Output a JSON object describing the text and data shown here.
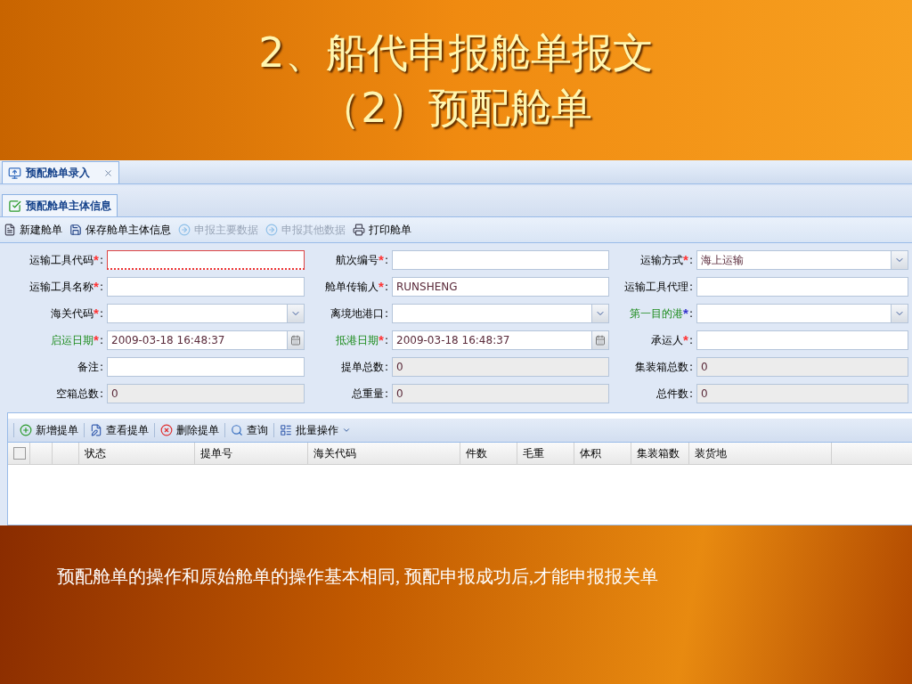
{
  "slide": {
    "title_lines": [
      "2、船代申报舱单报文",
      "（2）预配舱单"
    ],
    "caption": "预配舱单的操作和原始舱单的操作基本相同, 预配申报成功后,才能申报报关单"
  },
  "app": {
    "tab": {
      "label": "预配舱单录入",
      "selected": true
    },
    "subtab": {
      "label": "预配舱单主体信息",
      "selected": true
    },
    "toolbar": [
      {
        "label": "新建舱单",
        "disabled": false
      },
      {
        "label": "保存舱单主体信息",
        "disabled": false
      },
      {
        "label": "申报主要数据",
        "disabled": true
      },
      {
        "label": "申报其他数据",
        "disabled": true
      },
      {
        "label": "打印舱单",
        "disabled": false
      }
    ],
    "form": [
      {
        "label": "运输工具代码",
        "star": "*",
        "color": "#ff3333",
        "colon": ":",
        "green": false,
        "kind": "text",
        "invalid": true
      },
      {
        "label": "航次编号",
        "star": "*",
        "color": "#ff3333",
        "colon": ":",
        "green": false,
        "kind": "text",
        "invalid": false
      },
      {
        "label": "运输方式",
        "star": "*",
        "color": "#ff3333",
        "colon": ":",
        "green": false,
        "kind": "select",
        "value": "海上运输",
        "invalid": false
      },
      {
        "label": "运输工具名称",
        "star": "*",
        "color": "#ff3333",
        "colon": ":",
        "green": false,
        "kind": "text",
        "invalid": false
      },
      {
        "label": "舱单传输人",
        "star": "*",
        "color": "#ff3333",
        "colon": ":",
        "green": false,
        "kind": "text",
        "value": "RUNSHENG",
        "invalid": false
      },
      {
        "label": "运输工具代理",
        "colon": ":",
        "green": false,
        "kind": "text",
        "invalid": false
      },
      {
        "label": "海关代码",
        "star": "*",
        "color": "#ff3333",
        "colon": ":",
        "green": false,
        "kind": "select",
        "invalid": false
      },
      {
        "label": "离境地港口",
        "colon": ":",
        "green": false,
        "kind": "select",
        "invalid": false
      },
      {
        "label": "第一目的港",
        "star": "*",
        "color": "#3333cc",
        "colon": ":",
        "green": true,
        "kind": "select",
        "invalid": false
      },
      {
        "label": "启运日期",
        "star": "*",
        "color": "#ff3333",
        "colon": ":",
        "green": true,
        "kind": "date",
        "value": "2009-03-18 16:48:37",
        "invalid": false
      },
      {
        "label": "抵港日期",
        "star": "*",
        "color": "#ff3333",
        "colon": ":",
        "green": true,
        "kind": "date",
        "value": "2009-03-18 16:48:37",
        "invalid": false
      },
      {
        "label": "承运人",
        "star": "*",
        "color": "#ff3333",
        "colon": ":",
        "green": false,
        "kind": "text",
        "invalid": false
      },
      {
        "label": "备注",
        "colon": ":",
        "green": false,
        "kind": "text",
        "invalid": false
      },
      {
        "label": "提单总数",
        "colon": ":",
        "green": false,
        "kind": "readonly",
        "value": "0",
        "invalid": false
      },
      {
        "label": "集装箱总数",
        "colon": ":",
        "green": false,
        "kind": "readonly",
        "value": "0",
        "invalid": false
      },
      {
        "label": "空箱总数",
        "colon": ":",
        "green": false,
        "kind": "readonly",
        "value": "0",
        "invalid": false
      },
      {
        "label": "总重量",
        "colon": ":",
        "green": false,
        "kind": "readonly",
        "value": "0",
        "invalid": false
      },
      {
        "label": "总件数",
        "colon": ":",
        "green": false,
        "kind": "readonly",
        "value": "0",
        "invalid": false
      }
    ],
    "grid_toolbar": [
      {
        "label": "新增提单",
        "dropdown": false
      },
      {
        "label": "查看提单",
        "dropdown": false
      },
      {
        "label": "删除提单",
        "dropdown": false
      },
      {
        "label": "查询",
        "dropdown": false
      },
      {
        "label": "批量操作",
        "dropdown": true
      }
    ],
    "table": {
      "select_all": {
        "checked": false
      },
      "columns": [
        "状态",
        "提单号",
        "海关代码",
        "件数",
        "毛重",
        "体积",
        "集装箱数",
        "装货地"
      ]
    }
  }
}
